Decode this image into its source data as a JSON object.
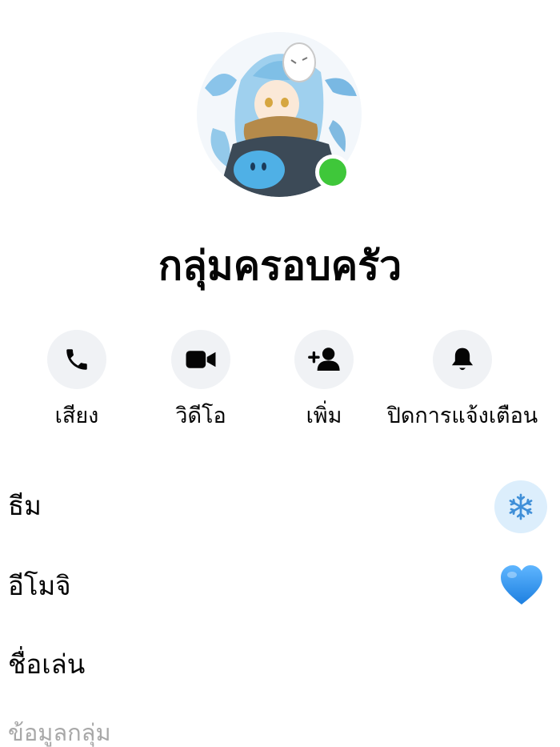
{
  "group": {
    "name": "กลุ่มครอบครัว",
    "online": true
  },
  "actions": [
    {
      "icon": "phone-icon",
      "label": "เสียง"
    },
    {
      "icon": "video-camera-icon",
      "label": "วิดีโอ"
    },
    {
      "icon": "add-person-icon",
      "label": "เพิ่ม"
    },
    {
      "icon": "bell-icon",
      "label": "ปิดการแจ้งเตือน"
    }
  ],
  "settings": {
    "theme_label": "ธีม",
    "theme_icon": "snowflake-icon",
    "emoji_label": "อีโมจิ",
    "emoji_icon": "blue-heart-icon",
    "nickname_label": "ชื่อเล่น"
  },
  "section": {
    "group_info_header": "ข้อมูลกลุ่ม"
  },
  "colors": {
    "online": "#3fc73a",
    "action_bg": "#f0f2f5",
    "header_grey": "#a8a8a8",
    "heart_blue": "#2b8ff0"
  }
}
